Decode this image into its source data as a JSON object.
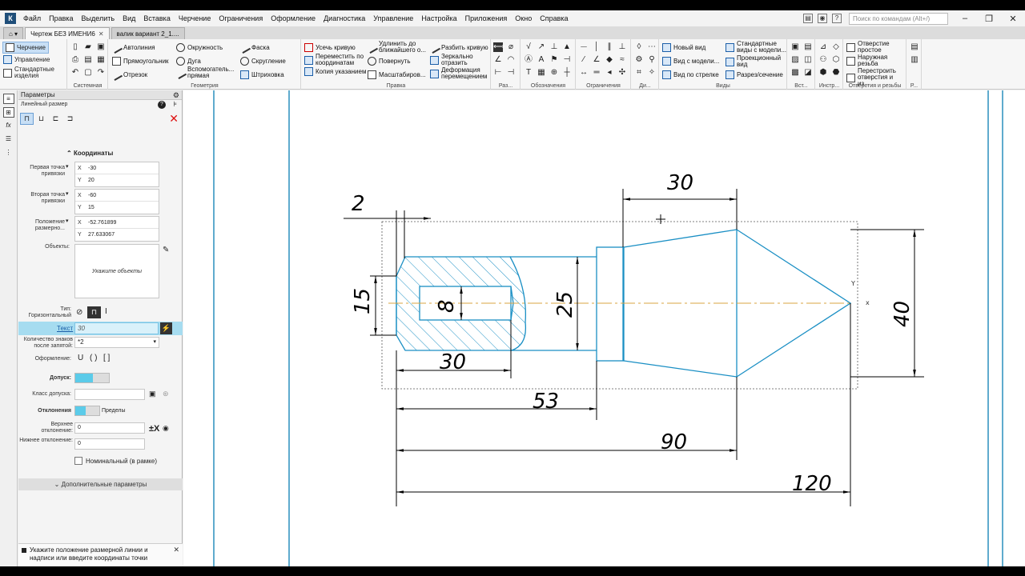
{
  "menu": [
    "Файл",
    "Правка",
    "Выделить",
    "Вид",
    "Вставка",
    "Черчение",
    "Ограничения",
    "Оформление",
    "Диагностика",
    "Управление",
    "Настройка",
    "Приложения",
    "Окно",
    "Справка"
  ],
  "search_placeholder": "Поиск по командам (Alt+/)",
  "tabs": [
    {
      "label": "Чертеж БЕЗ ИМЕНИ6",
      "active": true
    },
    {
      "label": "валик вариант 2_1....",
      "active": false
    }
  ],
  "ribbon": {
    "modes": [
      "Черчение",
      "Управление",
      "Стандартные изделия"
    ],
    "system_label": "Системная",
    "geometry": {
      "label": "Геометрия",
      "col1": [
        "Автолиния",
        "Прямоугольник",
        "Отрезок"
      ],
      "col2": [
        "Окружность",
        "Дуга",
        "Вспомогатель... прямая"
      ],
      "col3": [
        "Фаска",
        "Скругление",
        "Штриховка"
      ]
    },
    "edit": {
      "label": "Правка",
      "col1": [
        "Усечь кривую",
        "Переместить по координатам",
        "Копия указанием"
      ],
      "col2": [
        "Удлинить до ближайшего о...",
        "Повернуть",
        "Масштабиров..."
      ],
      "col3": [
        "Разбить кривую",
        "Зеркально отразить",
        "Деформация перемещением"
      ]
    },
    "small_groups": [
      "Раз...",
      "Обозначения",
      "Ограничения",
      "Ди...",
      "Вст...",
      "Инстр...",
      "Р..."
    ],
    "views": {
      "label": "Виды",
      "col1": [
        "Новый вид",
        "Вид с модели...",
        "Вид по стрелке"
      ],
      "col2": [
        "Стандартные виды с модели...",
        "Проекционный вид",
        "Разрез/сечение"
      ]
    },
    "holes": {
      "label": "Отверстия и резьбы",
      "items": [
        "Отверстие простое",
        "Наружная резьба",
        "Перестроить отверстия и из..."
      ]
    }
  },
  "panel": {
    "title": "Параметры",
    "subtitle": "Линейный размер",
    "section_coords": "Координаты",
    "point1": {
      "label": "Первая точка привязки",
      "x": "-30",
      "y": "20"
    },
    "point2": {
      "label": "Вторая точка привязки",
      "x": "-60",
      "y": "15"
    },
    "position": {
      "label": "Положение размерно...",
      "x": "-52.761899",
      "y": "27.633067"
    },
    "objects_label": "Объекты:",
    "objects_placeholder": "Укажите объекты",
    "type_label": "Тип:",
    "type_value": "Горизонтальный",
    "text_label": "Текст",
    "text_value": "30",
    "decimals_label": "Количество знаков после запятой:",
    "decimals_value": "*2",
    "format_label": "Оформление:",
    "format_options": [
      "U",
      "( )",
      "[ ]"
    ],
    "tolerance_label": "Допуск:",
    "tol_class_label": "Класс допуска:",
    "deviations_label": "Отклонения",
    "limits_label": "Пределы",
    "upper_label": "Верхнее отклонение:",
    "upper_value": "0",
    "lower_label": "Нижнее отклонение:",
    "lower_value": "0",
    "nominal_label": "Номинальный (в рамке)",
    "more_label": "Дополнительные параметры",
    "hint": "Укажите положение размерной линии и надписи или введите координаты точки"
  },
  "drawing": {
    "dimensions": [
      "2",
      "30",
      "15",
      "8",
      "25",
      "30",
      "53",
      "90",
      "120",
      "40"
    ],
    "colors": {
      "part": "#1a8fc4",
      "dim": "#000000",
      "axis": "#d9a441",
      "hatch": "#1a8fc4",
      "frame": "#2a8fbd"
    }
  }
}
